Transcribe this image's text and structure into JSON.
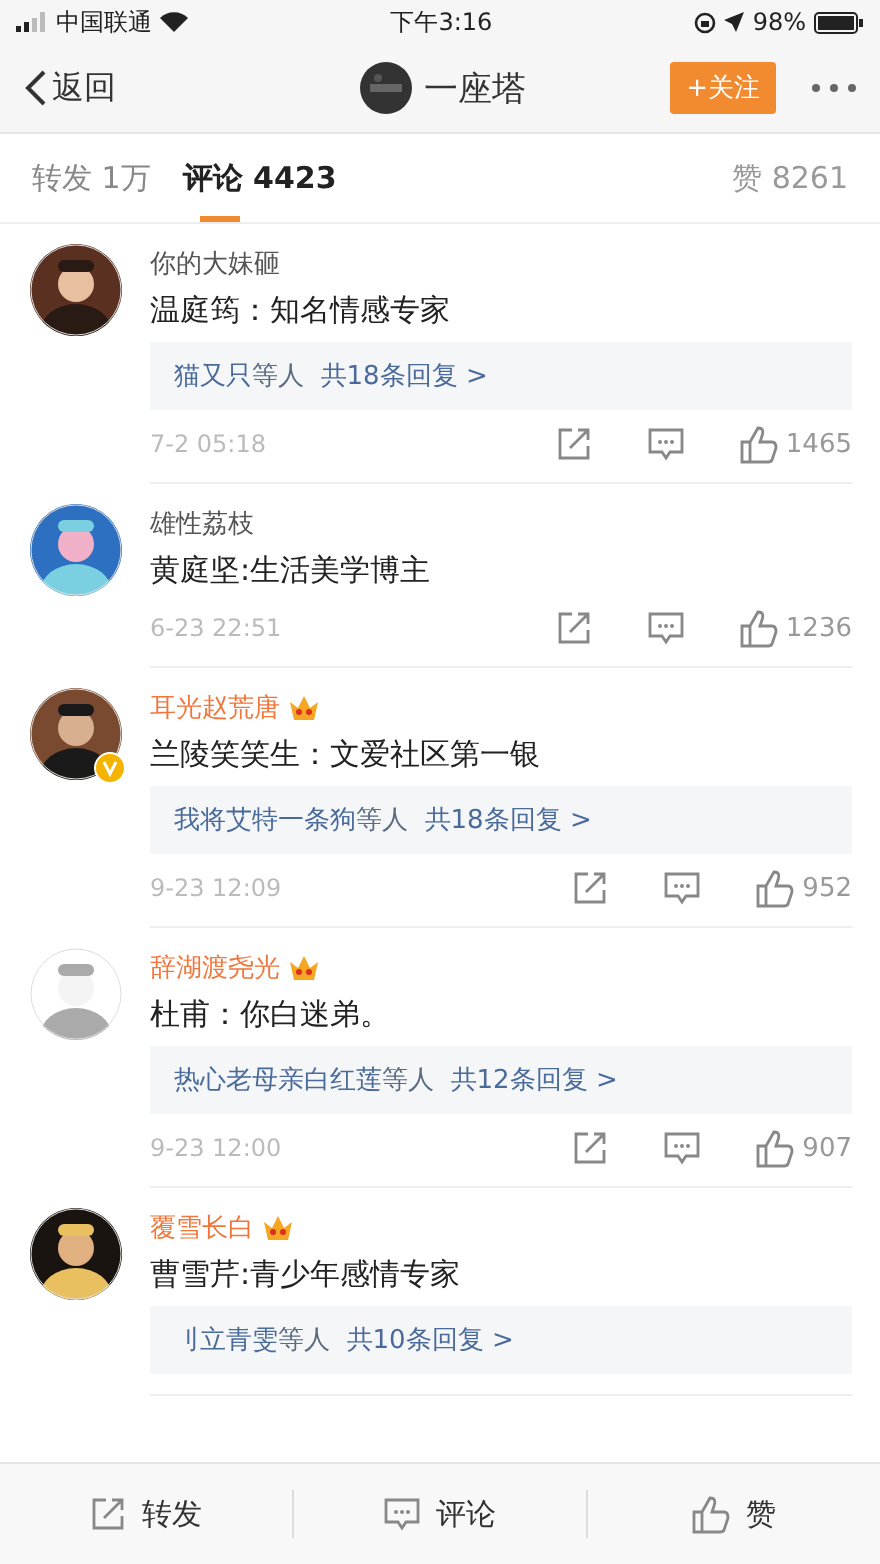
{
  "status_bar": {
    "carrier": "中国联通",
    "time": "下午3:16",
    "battery": "98%"
  },
  "nav": {
    "back": "返回",
    "title": "一座塔",
    "follow": "+关注"
  },
  "tabs": [
    {
      "label": "转发 1万",
      "selected": false
    },
    {
      "label": "评论 4423",
      "selected": true
    }
  ],
  "likes_total": "赞 8261",
  "comments": [
    {
      "name": "你的大妹砸",
      "vip": false,
      "verified": false,
      "text": "温庭筠：知名情感专家",
      "reply": {
        "names": "猫又只",
        "suffix": "等人",
        "count": "共18条回复 >"
      },
      "time": "7-2 05:18",
      "likes": "1465"
    },
    {
      "name": "雄性荔枝",
      "vip": false,
      "verified": false,
      "text": "黄庭坚:生活美学博主",
      "time": "6-23 22:51",
      "likes": "1236"
    },
    {
      "name": "耳光赵荒唐",
      "vip": true,
      "verified": true,
      "text": "兰陵笑笑生：文爱社区第一银",
      "reply": {
        "names": "我将艾特一条狗",
        "suffix": "等人",
        "count": "共18条回复 >"
      },
      "time": "9-23 12:09",
      "likes": "952"
    },
    {
      "name": "辞湖渡尧光",
      "vip": true,
      "verified": false,
      "text": "杜甫：你白迷弟。",
      "reply": {
        "names": "热心老母亲白红莲",
        "suffix": "等人",
        "count": "共12条回复 >"
      },
      "time": "9-23 12:00",
      "likes": "907"
    },
    {
      "name": "覆雪长白",
      "vip": true,
      "verified": false,
      "text": "曹雪芹:青少年感情专家",
      "reply": {
        "names": "刂立青雯",
        "suffix": "等人",
        "count": "共10条回复 >"
      }
    }
  ],
  "bottom_bar": [
    {
      "kind": "repost",
      "label": "转发"
    },
    {
      "kind": "comment",
      "label": "评论"
    },
    {
      "kind": "like",
      "label": "赞"
    }
  ]
}
